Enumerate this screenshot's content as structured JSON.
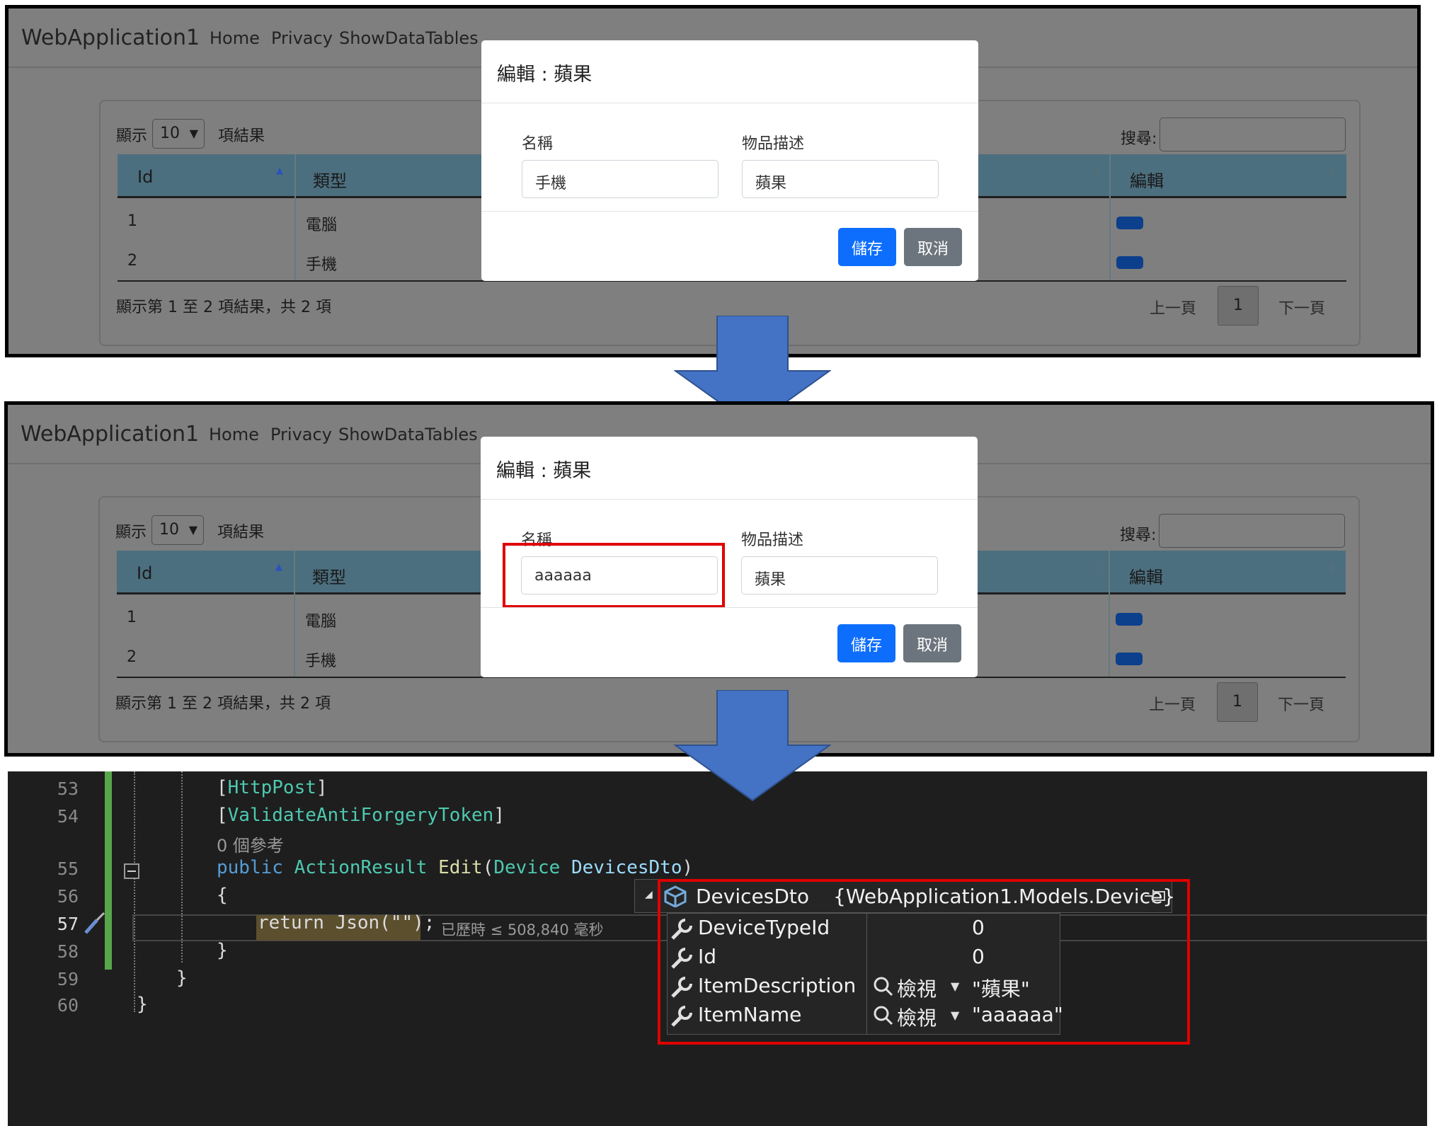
{
  "app": {
    "brand": "WebApplication1",
    "nav": [
      "Home",
      "Privacy",
      "ShowDataTables"
    ]
  },
  "table": {
    "show_prefix": "顯示",
    "page_length": "10",
    "show_suffix": "項結果",
    "search_label": "搜尋:",
    "columns": [
      "Id",
      "類型",
      "編輯"
    ],
    "rows": [
      {
        "id": "1",
        "type": "電腦"
      },
      {
        "id": "2",
        "type": "手機"
      }
    ],
    "info": "顯示第 1 至 2 項結果，共 2 項",
    "prev": "上一頁",
    "page": "1",
    "next": "下一頁"
  },
  "modal1": {
    "title": "編輯 : 蘋果",
    "name_label": "名稱",
    "name_value": "手機",
    "desc_label": "物品描述",
    "desc_value": "蘋果",
    "save": "儲存",
    "cancel": "取消"
  },
  "modal2": {
    "title": "編輯 : 蘋果",
    "name_label": "名稱",
    "name_value": "aaaaaa",
    "desc_label": "物品描述",
    "desc_value": "蘋果",
    "save": "儲存",
    "cancel": "取消"
  },
  "code": {
    "line_numbers": [
      "53",
      "54",
      "55",
      "56",
      "57",
      "58",
      "59",
      "60"
    ],
    "attr1": "HttpPost",
    "attr2": "ValidateAntiForgeryToken",
    "refs": "0 個參考",
    "sig_public": "public",
    "sig_type": "ActionResult",
    "sig_method": "Edit",
    "sig_ptype": "Device",
    "sig_pname": "DevicesDto",
    "open_brace": "{",
    "return_stmt": "return Json(\"\");",
    "close_brace": "}",
    "elapsed": "已歷時 ≤ 508,840 毫秒"
  },
  "datatip": {
    "name": "DevicesDto",
    "value": "{WebApplication1.Models.Device}",
    "view_label": "檢視",
    "props": [
      {
        "name": "DeviceTypeId",
        "value": "0"
      },
      {
        "name": "Id",
        "value": "0"
      },
      {
        "name": "ItemDescription",
        "value": "\"蘋果\""
      },
      {
        "name": "ItemName",
        "value": "\"aaaaaa\""
      }
    ]
  },
  "colors": {
    "primary": "#0d6efd",
    "secondary": "#6c757d",
    "highlight_red": "#e00000",
    "arrow_blue": "#4472c4",
    "editor_bg": "#1e1e1e"
  }
}
